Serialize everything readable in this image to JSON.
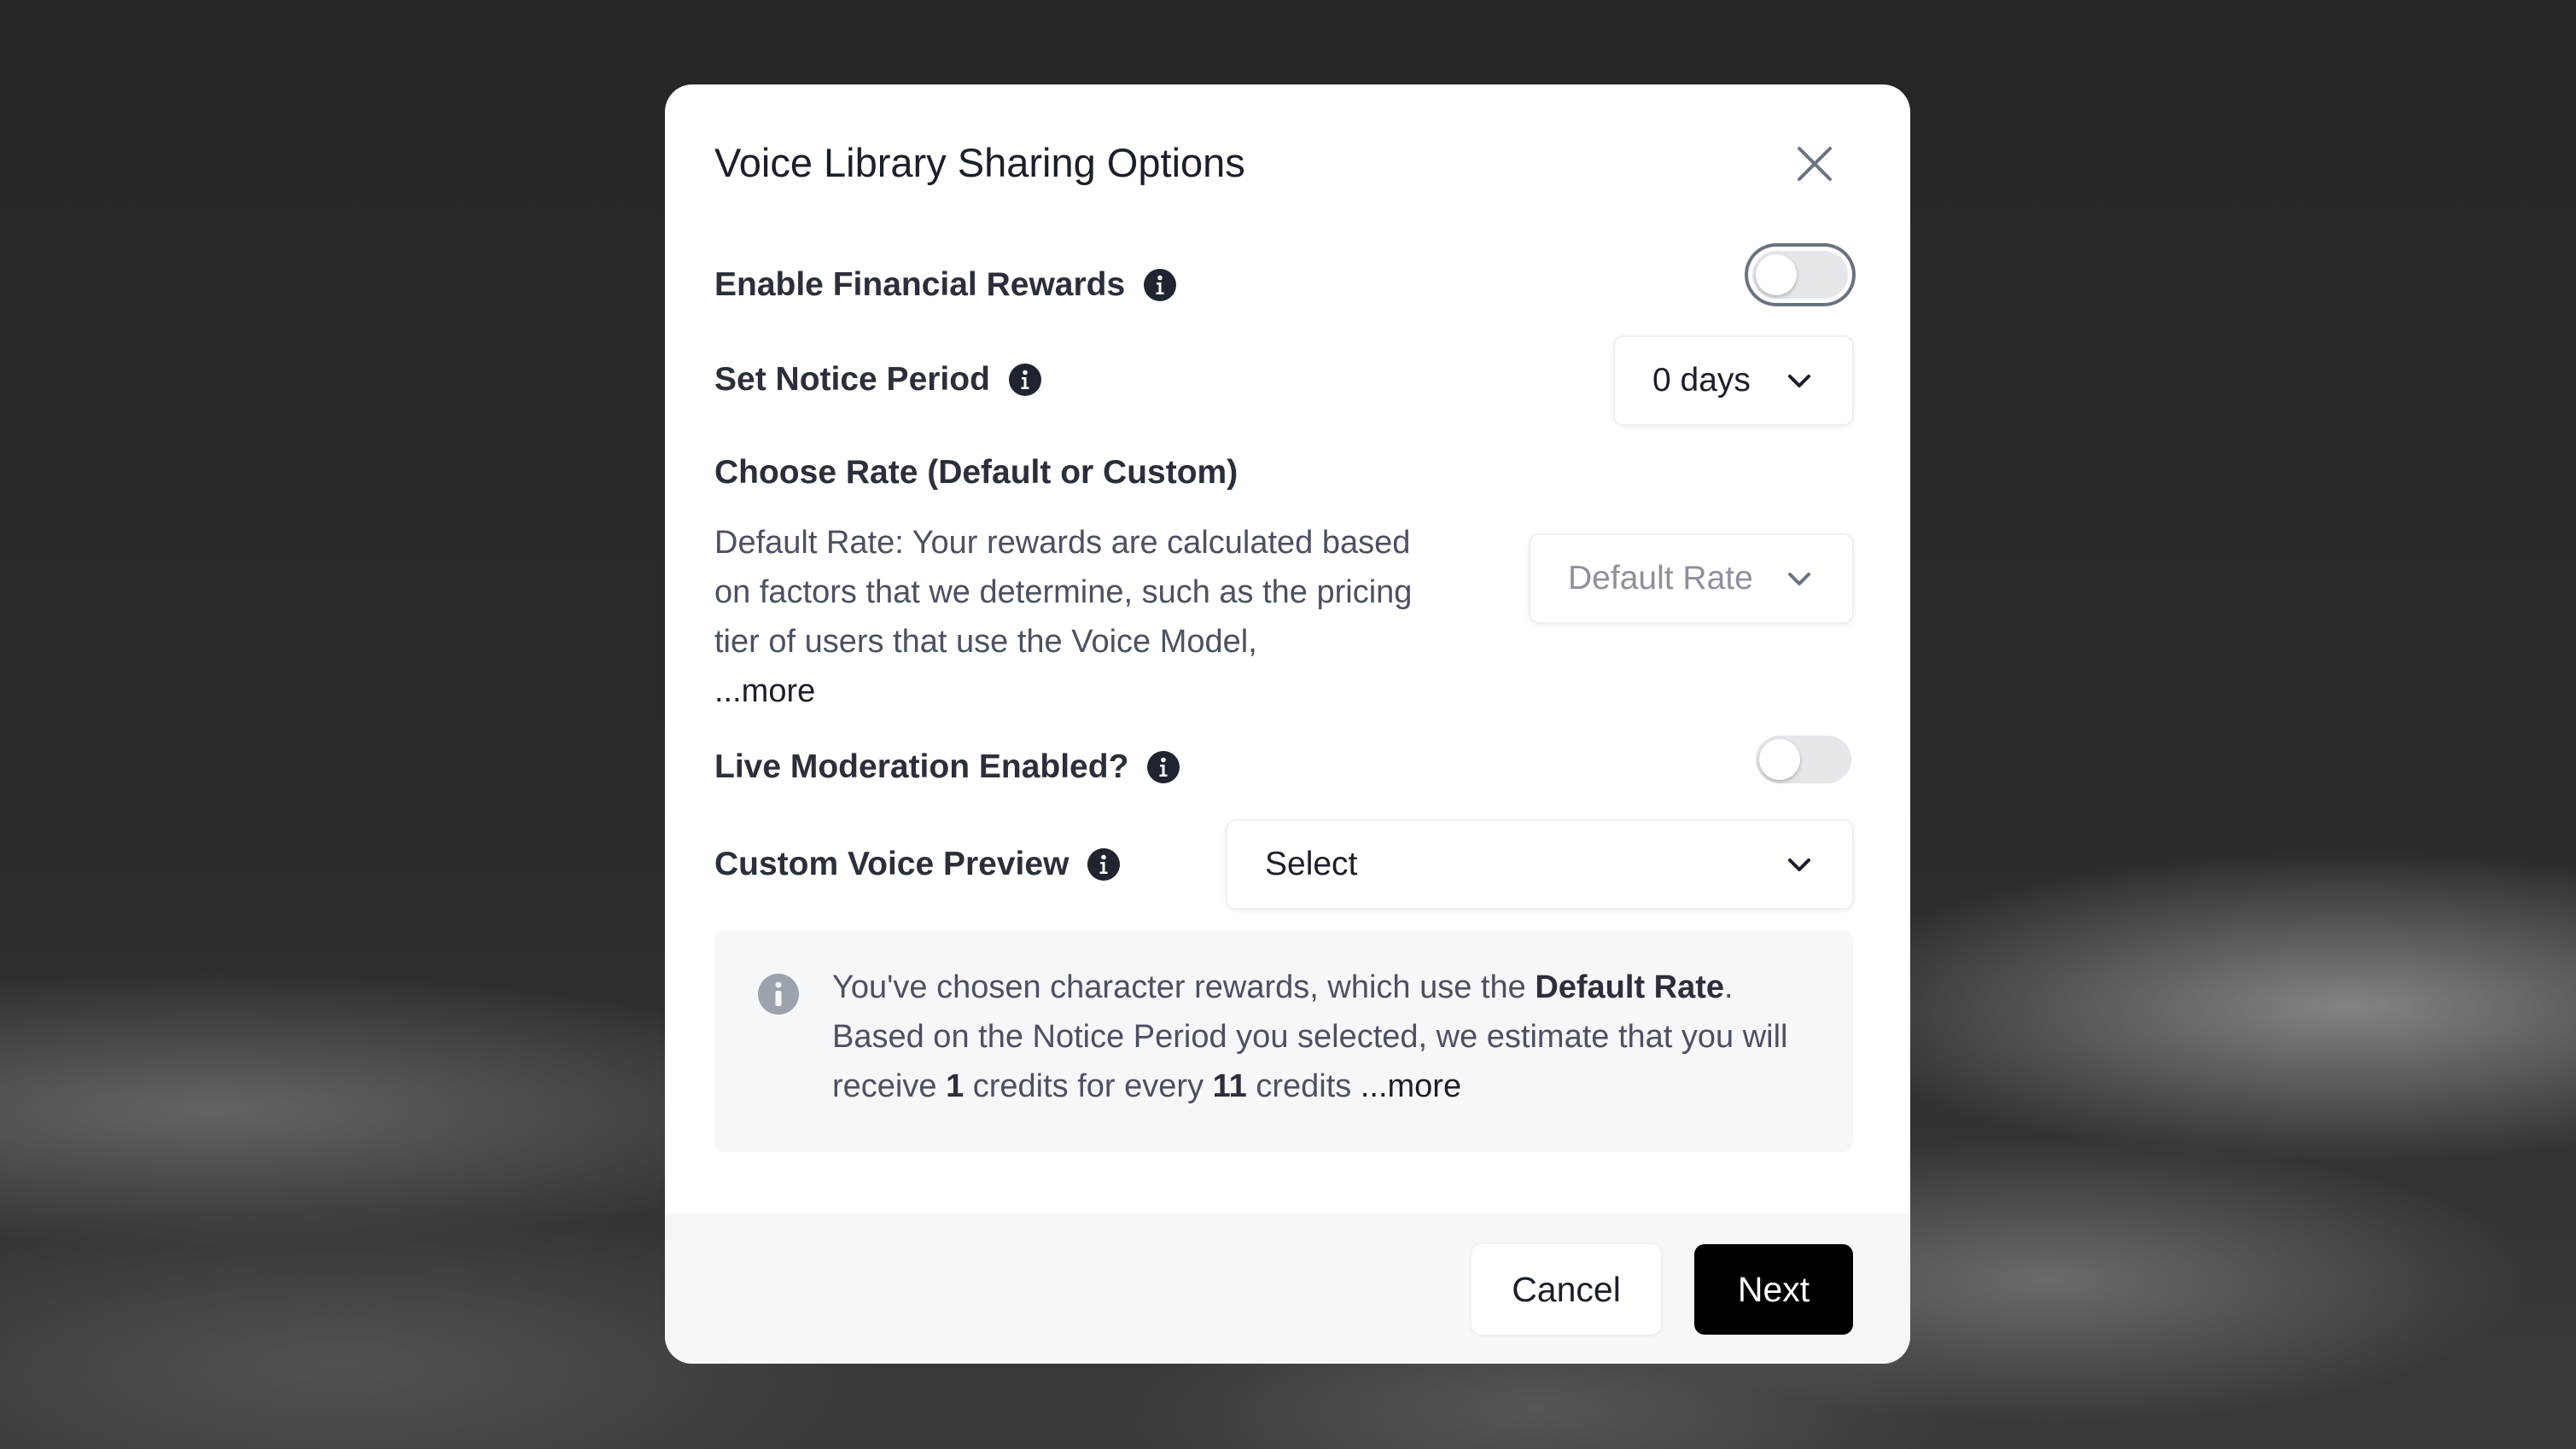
{
  "dialog": {
    "title": "Voice Library Sharing Options",
    "close_icon": "close-icon"
  },
  "financial_rewards": {
    "label": "Enable Financial Rewards",
    "enabled": false
  },
  "notice_period": {
    "label": "Set Notice Period",
    "value": "0 days"
  },
  "rate": {
    "label": "Choose Rate (Default or Custom)",
    "description": "Default Rate: Your rewards are calculated based on factors that we determine, such as the pricing tier of users that use the Voice Model,",
    "more_link": "...more",
    "value": "Default Rate"
  },
  "live_moderation": {
    "label": "Live Moderation Enabled?",
    "enabled": false
  },
  "custom_voice_preview": {
    "label": "Custom Voice Preview",
    "value": "Select"
  },
  "notice": {
    "text_1": "You've chosen character rewards, which use the ",
    "rate_name": "Default Rate",
    "text_2": ". Based on the Notice Period you selected, we estimate that you will receive ",
    "credits_received": "1",
    "text_3": " credits for every ",
    "credits_per": "11",
    "text_4": " credits ",
    "more_link": "...more"
  },
  "footer": {
    "cancel_label": "Cancel",
    "next_label": "Next"
  },
  "colors": {
    "primary_button": "#000000",
    "toggle_off": "#e5e7eb",
    "text_dark": "#1b1f29",
    "text_muted": "#4b5160",
    "info_icon": "#1f2430",
    "notice_icon": "#9ca3af"
  }
}
